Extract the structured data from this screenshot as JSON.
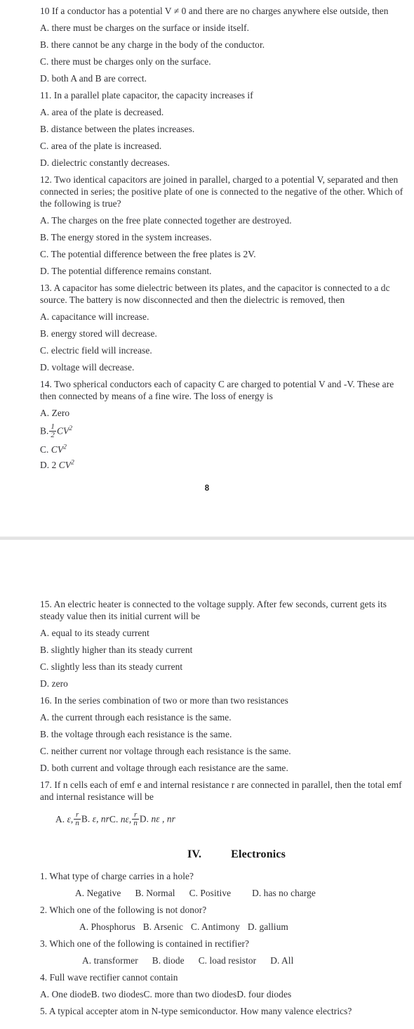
{
  "document": {
    "type": "scanned-exam-paper",
    "background_color": "#ffffff",
    "text_color": "#2f2f33",
    "page_gap_color": "#e3e3e3"
  },
  "page_one": {
    "folio": "8",
    "questions": [
      {
        "number": "10",
        "stem": [
          "10 If a conductor has a potential V ≠ 0 and there are no charges anywhere else outside, then"
        ],
        "options": [
          "A. there must be charges on the surface or inside itself.",
          "B. there cannot be any charge in the body of the conductor.",
          "C. there must be charges only on the surface.",
          "D. both A  and  B are correct."
        ]
      },
      {
        "number": "11",
        "stem": [
          "11. In a parallel plate capacitor, the capacity increases if"
        ],
        "options": [
          "A. area of the plate is decreased.",
          "B. distance between the plates increases.",
          "C. area of the plate is increased.",
          "D. dielectric constantly decreases."
        ]
      },
      {
        "number": "12",
        "stem": [
          "12. Two identical capacitors are joined in parallel, charged to a potential V, separated and then",
          "connected in series; the positive plate of one is connected to the negative of the other. Which of",
          "the following is true?"
        ],
        "options": [
          "A. The charges on the free plate connected together are destroyed.",
          "B. The energy stored in the system increases.",
          "C. The potential difference between the free plates is 2V.",
          "D. The potential difference remains constant."
        ]
      },
      {
        "number": "13",
        "stem": [
          "13. A capacitor has some dielectric between its plates, and the capacitor is connected to a dc",
          "source. The battery is now disconnected and then the dielectric is removed, then"
        ],
        "options": [
          "A. capacitance will increase.",
          "B. energy stored will decrease.",
          "C. electric field will increase.",
          "D. voltage will decrease."
        ]
      },
      {
        "number": "14",
        "stem": [
          "14. Two spherical conductors each of capacity C are charged to potential V and -V. These are",
          "then connected by means of a fine wire. The loss of energy is"
        ],
        "math_options": [
          {
            "label": "A.",
            "text": "Zero"
          },
          {
            "label": "B.",
            "fraction": {
              "num": "1",
              "den": "2"
            },
            "expr": "CV",
            "exponent": "2"
          },
          {
            "label": "C.",
            "expr": "CV",
            "exponent": "2"
          },
          {
            "label": "D.",
            "prefix": "2 ",
            "expr": "CV",
            "exponent": "2"
          }
        ]
      }
    ]
  },
  "page_two": {
    "questions": [
      {
        "number": "15",
        "stem": [
          "15. An electric heater is connected to the voltage supply. After few seconds, current gets its",
          "steady value then its initial current will be"
        ],
        "options": [
          "A. equal to its steady current",
          "B. slightly higher than its steady current",
          "C. slightly less than its steady current",
          "D. zero"
        ]
      },
      {
        "number": "16",
        "stem": [
          "16. In the series combination of two or more than two resistances"
        ],
        "options": [
          "A. the current through each resistance is the same.",
          "B. the voltage through each resistance is the same.",
          "C. neither current nor voltage through each resistance is the same.",
          "D. both current and voltage through each resistance are the same."
        ]
      },
      {
        "number": "17",
        "stem": [
          "17. If n cells each of emf e and internal resistance r are connected in parallel, then the total emf",
          "and internal resistance will be"
        ],
        "inline_math_options": [
          {
            "label": "A.",
            "symbol": "ε,",
            "fraction": {
              "num": "r",
              "den": "n"
            }
          },
          {
            "label": "B.",
            "symbol": "ε, nr"
          },
          {
            "label": "C.",
            "symbol": "nε,",
            "fraction": {
              "num": "r",
              "den": "n"
            }
          },
          {
            "label": "D.",
            "symbol": "nε , nr"
          }
        ]
      }
    ],
    "section": {
      "numeral": "IV.",
      "title": "Electronics",
      "questions": [
        {
          "number": "1",
          "stem": "1. What type of charge carries in a hole?",
          "inline_options": [
            "A.  Negative",
            "B. Normal",
            "C. Positive",
            "D. has no charge"
          ]
        },
        {
          "number": "2",
          "stem": "2. Which one of the following is not donor?",
          "inline_options": [
            "A.  Phosphorus",
            "B. Arsenic",
            "C. Antimony",
            "D. gallium"
          ]
        },
        {
          "number": "3",
          "stem": "3. Which one of the following is contained in rectifier?",
          "inline_options": [
            "A. transformer",
            "B. diode",
            "C. load resistor",
            "D. All"
          ]
        },
        {
          "number": "4",
          "stem": "4.  Full wave rectifier cannot contain",
          "options_row": [
            "A. One diode",
            "B. two diodes",
            "C. more than two diodes",
            "D. four diodes"
          ]
        },
        {
          "number": "5",
          "stem": "5. A typical accepter atom in N-type semiconductor. How many valence electrics?"
        }
      ]
    }
  }
}
